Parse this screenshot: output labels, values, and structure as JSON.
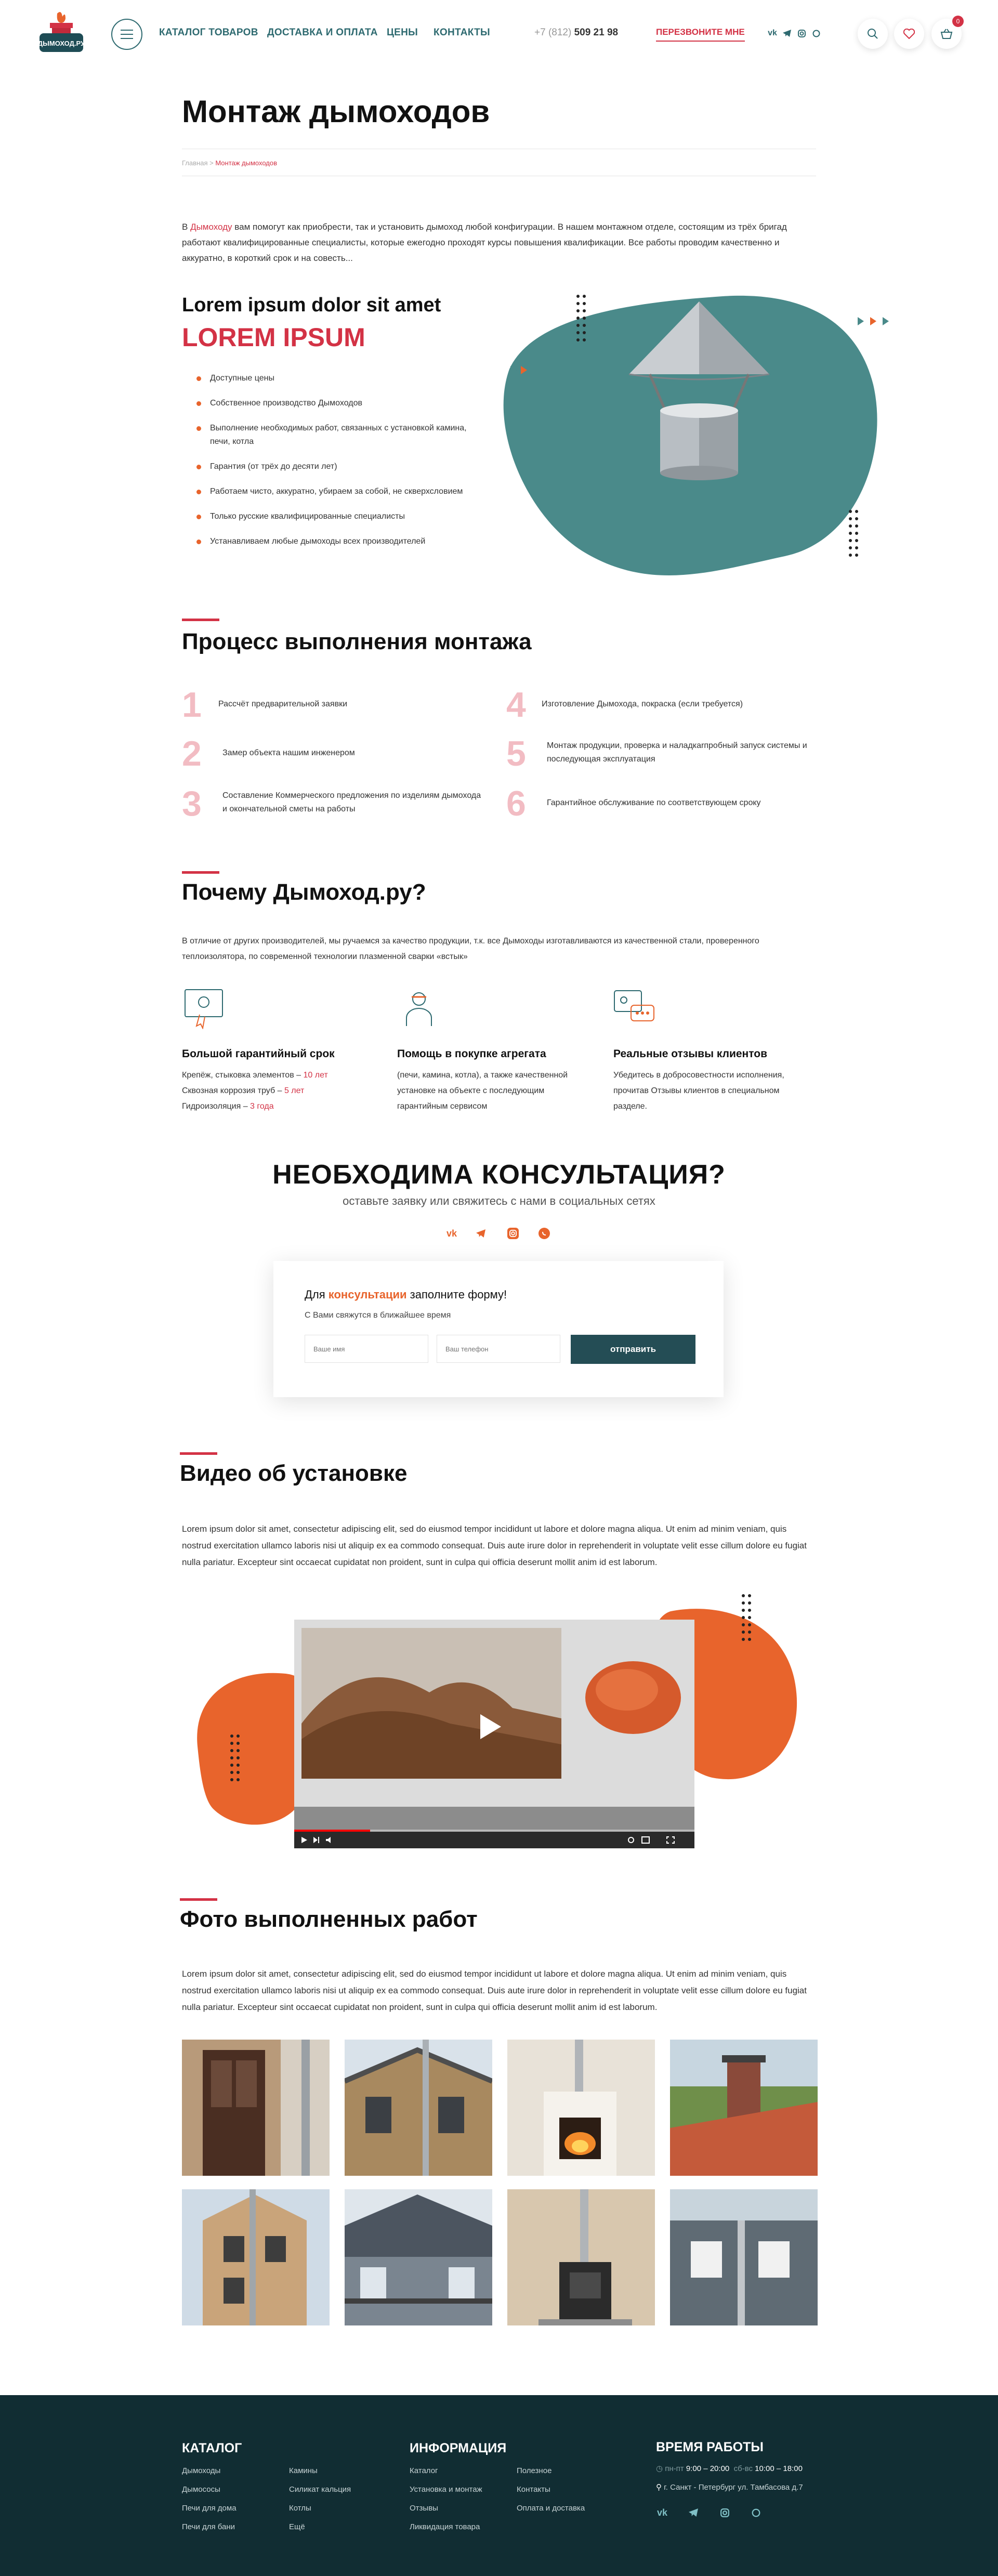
{
  "header": {
    "logo_text": "ДЫМОХОД.РУ",
    "nav": [
      "КАТАЛОГ ТОВАРОВ",
      "ДОСТАВКА И ОПЛАТА",
      "ЦЕНЫ",
      "КОНТАКТЫ"
    ],
    "phone_prefix": "+7 (812)",
    "phone_number": "509 21 98",
    "callback": "ПЕРЕЗВОНИТЕ МНЕ",
    "social_icons": [
      "vk-icon",
      "telegram-icon",
      "instagram-icon",
      "whatsapp-icon"
    ],
    "cart_count": "0"
  },
  "page": {
    "title": "Монтаж дымоходов",
    "breadcrumb": [
      "Главная",
      "Монтаж дымоходов"
    ],
    "intro_link": "Дымоходу",
    "intro_before": "В ",
    "intro_after": " вам помогут как приобрести, так и установить дымоход любой конфигурации. В нашем монтажном отделе, состоящим из трёх бригад работают квалифицированные специалисты, которые ежегодно проходят курсы повышения квалификации. Все работы проводим качественно и аккуратно, в короткий срок и на совесть..."
  },
  "hero": {
    "title": "Lorem ipsum dolor sit amet",
    "subtitle": "LOREM IPSUM",
    "bullets": [
      "Доступные цены",
      "Собственное производство  Дымоходов",
      "Выполнение необходимых работ, связанных с установкой камина, печи, котла",
      "Гарантия (от трёх до десяти лет)",
      "Работаем чисто, аккуратно, убираем за собой, не скверхсловием",
      "Только русские квалифицированные специалисты",
      "Устанавливаем любые дымоходы всех производителей"
    ]
  },
  "process": {
    "title": "Процесс выполнения монтажа",
    "steps": [
      {
        "num": "1",
        "text": "Рассчёт предварительной заявки"
      },
      {
        "num": "2",
        "text": "Замер объекта нашим инженером"
      },
      {
        "num": "3",
        "text": "Составление Коммерческого предложения по изделиям дымохода и окончательной сметы на  работы"
      },
      {
        "num": "4",
        "text": "Изготовление Дымохода, покраска (если требуется)"
      },
      {
        "num": "5",
        "text": "Монтаж продукции, проверка и наладкаrпробный запуск системы и последующая эксплуатация"
      },
      {
        "num": "6",
        "text": "Гарантийное обслуживание по соответствующем сроку"
      }
    ]
  },
  "why": {
    "title": "Почему Дымоход.ру?",
    "text": "В отличие от других производителей, мы ручаемся за качество продукции, т.к. все Дымоходы изготавливаются из качественной стали, проверенного теплоизолятора, по современной технологии плазменной сварки «встык»",
    "features": [
      {
        "title": "Большой гарантийный срок",
        "lines": [
          [
            "Крепёж, стыковка элементов – ",
            "10 лет"
          ],
          [
            "Сквозная коррозия труб – ",
            "5 лет"
          ],
          [
            "Гидроизоляция – ",
            "3 года"
          ]
        ]
      },
      {
        "title": "Помощь в покупке агрегата",
        "text": "(печи, камина, котла), а также качественной установке на объекте с последующим гарантийным сервисом"
      },
      {
        "title": "Реальные отзывы клиентов",
        "text": "Убедитесь в добросовестности исполнения, прочитав Отзывы клиентов в специальном разделе."
      }
    ]
  },
  "consult": {
    "title": "НЕОБХОДИМА КОНСУЛЬТАЦИЯ?",
    "subtitle": "оставьте заявку или свяжитесь с нами в социальных сетях",
    "form_pre": "Для ",
    "form_hl": "консультации",
    "form_post": " заполните форму!",
    "form_sub": "С Вами свяжутся в ближайшее время",
    "name_placeholder": "Ваше имя",
    "phone_placeholder": "Ваш телефон",
    "submit": "отправить"
  },
  "video": {
    "title": "Видео об установке",
    "text": "Lorem ipsum dolor sit amet, consectetur adipiscing elit, sed do eiusmod tempor incididunt ut labore et dolore magna aliqua. Ut enim ad minim veniam, quis nostrud exercitation ullamco laboris nisi ut aliquip ex ea commodo consequat. Duis aute irure dolor in reprehenderit in voluptate velit esse cillum dolore eu fugiat nulla pariatur. Excepteur sint occaecat cupidatat non proident, sunt in culpa qui officia deserunt mollit anim id est laborum.",
    "progress": 0.19
  },
  "photos": {
    "title": "Фото выполненных работ",
    "text": "Lorem ipsum dolor sit amet, consectetur adipiscing elit, sed do eiusmod tempor incididunt ut labore et dolore magna aliqua. Ut enim ad minim veniam, quis nostrud exercitation ullamco laboris nisi ut aliquip ex ea commodo consequat. Duis aute irure dolor in reprehenderit in voluptate velit esse cillum dolore eu fugiat nulla pariatur. Excepteur sint occaecat cupidatat non proident, sunt in culpa qui officia deserunt mollit anim id est laborum."
  },
  "footer": {
    "catalog_title": "КАТАЛОГ",
    "catalog_col1": [
      "Дымоходы",
      "Дымососы",
      "Печи для дома",
      "Печи для бани"
    ],
    "catalog_col2": [
      "Камины",
      "Силикат кальция",
      "Котлы",
      "Ещё"
    ],
    "info_title": "ИНФОРМАЦИЯ",
    "info_col1": [
      "Каталог",
      "Установка и монтаж",
      "Отзывы",
      "Ликвидация товара"
    ],
    "info_col2": [
      "Полезное",
      "Контакты",
      "Оплата и доставка"
    ],
    "hours_title": "ВРЕМЯ РАБОТЫ",
    "hours_wd_label": "пн-пт",
    "hours_wd": "9:00 – 20:00",
    "hours_we_label": "сб-вс",
    "hours_we": "10:00 – 18:00",
    "address": "г. Санкт - Петербург ул. Тамбасова д.7",
    "social_icons": [
      "vk-icon",
      "telegram-icon",
      "instagram-icon",
      "whatsapp-icon"
    ]
  },
  "colors": {
    "accent": "#d33245",
    "orange": "#e8642c",
    "teal": "#4a8a8a",
    "dark": "#112d33"
  }
}
